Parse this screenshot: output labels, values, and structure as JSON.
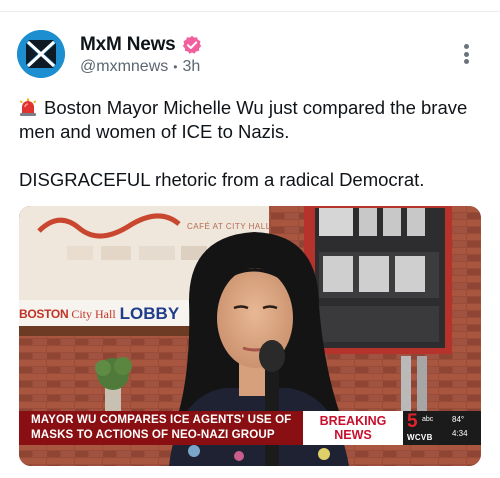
{
  "post": {
    "author_name": "MxM News",
    "handle": "@mxmnews",
    "separator": "•",
    "time_ago": "3h",
    "text_line1": "Boston Mayor Michelle Wu just compared the brave men and women of ICE to Nazis.",
    "text_line2": "DISGRACEFUL rhetoric from a radical Democrat."
  },
  "icons": {
    "avatar": "mxm-logo-icon",
    "verified": "verified-badge-icon",
    "more": "more-options-icon",
    "emoji": "police-siren-icon"
  },
  "media": {
    "background_signage": {
      "cafe_text": "CAFÉ AT CITY HALL",
      "lobby_part1": "BOSTON",
      "lobby_part2": "City Hall",
      "lobby_part3": "LOBBY"
    },
    "lower_third": {
      "headline_line1": "MAYOR WU COMPARES ICE AGENTS' USE OF",
      "headline_line2": "MASKS TO ACTIONS OF NEO-NAZI GROUP",
      "breaking_line1": "BREAKING",
      "breaking_line2": "NEWS",
      "station_number": "5",
      "network": "abc",
      "station_call": "WCVB",
      "temperature": "84°",
      "time": "4:34"
    }
  },
  "colors": {
    "avatar_bg": "#1d8fd1",
    "verified_badge": "#f25f9e",
    "lower_third_red": "#8a0f12",
    "breaking_red": "#c8102e"
  }
}
